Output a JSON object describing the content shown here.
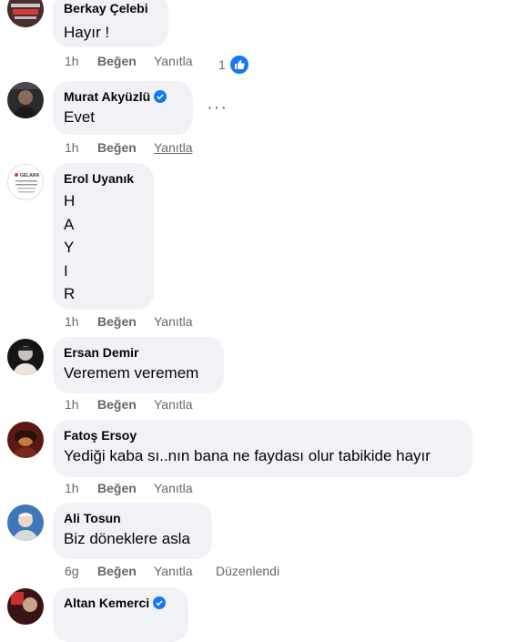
{
  "comments": [
    {
      "author": "Berkay Çelebi",
      "text": "Hayır !",
      "time": "1h",
      "like": "Beğen",
      "reply": "Yanıtla",
      "reactions": "1"
    },
    {
      "author": "Murat Akyüzlü",
      "text": "Evet",
      "time": "1h",
      "like": "Beğen",
      "reply": "Yanıtla",
      "verified": true
    },
    {
      "author": "Erol Uyanık",
      "letters": [
        "H",
        "A",
        "Y",
        "I",
        "R"
      ],
      "time": "1h",
      "like": "Beğen",
      "reply": "Yanıtla",
      "avatar_text": "GELARA"
    },
    {
      "author": "Ersan Demir",
      "text": "Veremem veremem",
      "time": "1h",
      "like": "Beğen",
      "reply": "Yanıtla"
    },
    {
      "author": "Fatoş Ersoy",
      "text": "Yediği kaba sı..nın bana ne faydası olur tabikide hayır",
      "time": "1h",
      "like": "Beğen",
      "reply": "Yanıtla"
    },
    {
      "author": "Ali Tosun",
      "text": "Biz döneklere asla",
      "time": "6g",
      "like": "Beğen",
      "reply": "Yanıtla",
      "edited": "Düzenlendi"
    },
    {
      "author": "Altan Kemerci",
      "verified": true
    }
  ],
  "colors": {
    "bubble": "#f0f2f5",
    "meta": "#65676b",
    "accent": "#1877f2"
  },
  "icons": {
    "verified": "verified-badge-icon",
    "like": "thumbs-up-icon",
    "more": "more-options-icon"
  }
}
